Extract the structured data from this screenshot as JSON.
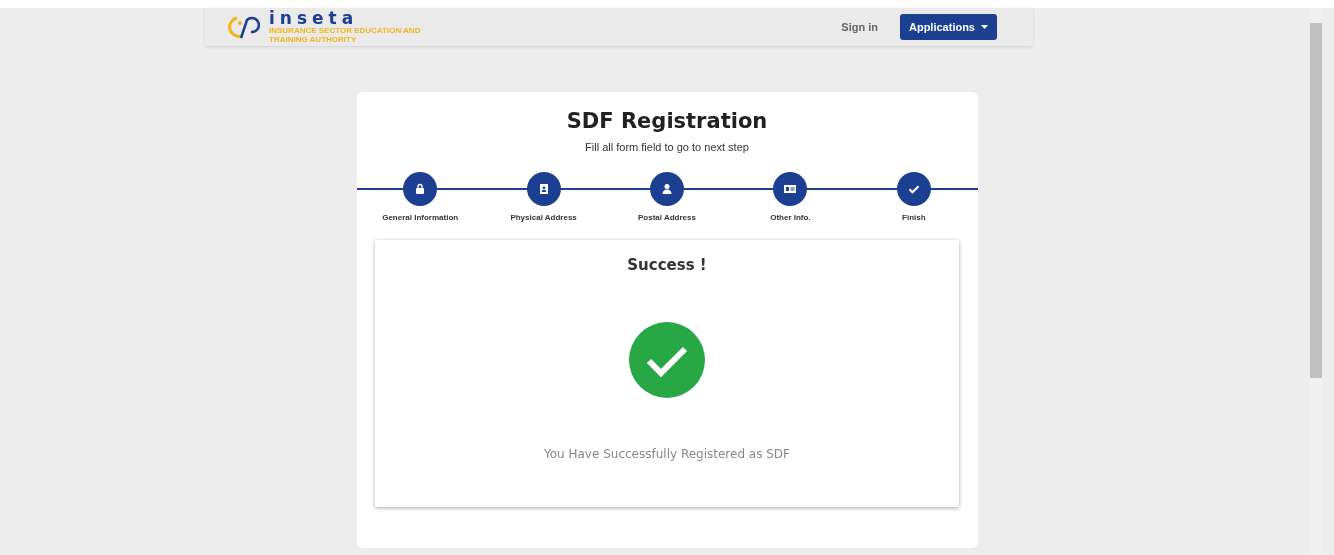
{
  "navbar": {
    "logo": {
      "name": "inseta",
      "tagline": "INSURANCE SECTOR EDUCATION AND TRAINING AUTHORITY"
    },
    "links": [
      {
        "label": "Sign in",
        "kind": "link"
      },
      {
        "label": "Applications",
        "kind": "dropdown"
      }
    ]
  },
  "card": {
    "title": "SDF Registration",
    "subtitle": "Fill all form field to go to next step",
    "steps": [
      {
        "label": "General Information",
        "kind": "lock"
      },
      {
        "label": "Physical Address",
        "kind": "contact"
      },
      {
        "label": "Postal Address",
        "kind": "user"
      },
      {
        "label": "Other Info.",
        "kind": "idcard"
      },
      {
        "label": "Finish",
        "kind": "check"
      }
    ],
    "result": {
      "heading": "Success !",
      "message": "You Have Successfully Registered as SDF"
    }
  }
}
